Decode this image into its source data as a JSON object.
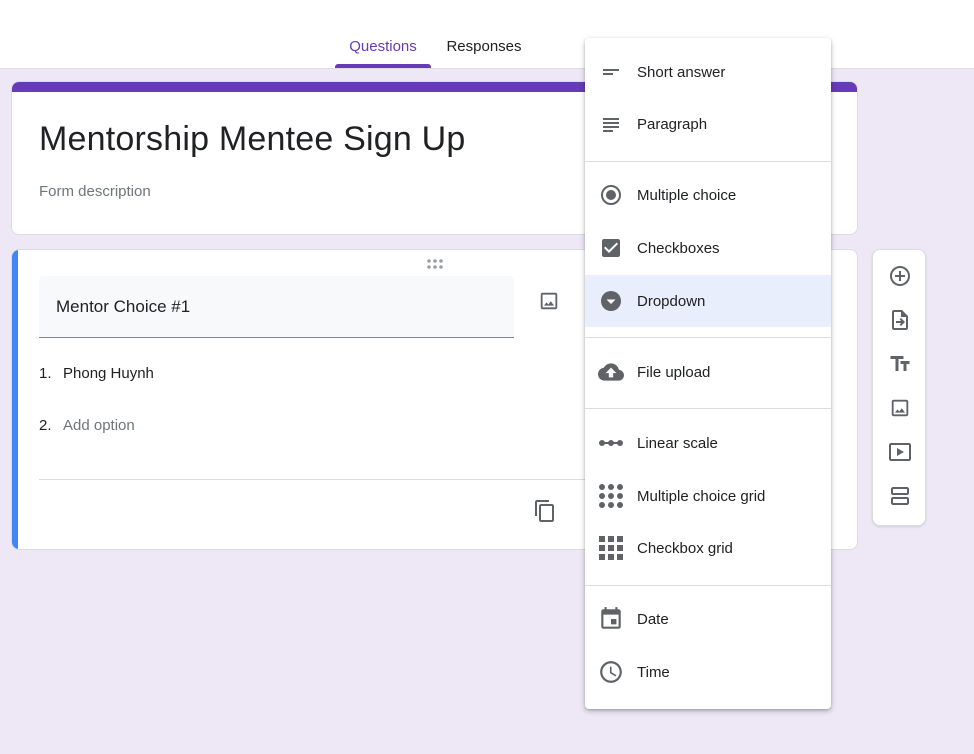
{
  "tabs": {
    "questions": "Questions",
    "responses": "Responses"
  },
  "form": {
    "title": "Mentorship Mentee Sign Up",
    "description_placeholder": "Form description"
  },
  "question": {
    "title": "Mentor Choice #1",
    "options": [
      {
        "num": "1.",
        "text": "Phong Huynh"
      },
      {
        "num": "2.",
        "text": "Add option"
      }
    ]
  },
  "menu": {
    "items": [
      {
        "label": "Short answer",
        "icon": "short-answer-icon"
      },
      {
        "label": "Paragraph",
        "icon": "paragraph-icon"
      },
      {
        "label": "Multiple choice",
        "icon": "radio-button-icon"
      },
      {
        "label": "Checkboxes",
        "icon": "checkbox-icon"
      },
      {
        "label": "Dropdown",
        "icon": "dropdown-circle-icon",
        "selected": true
      },
      {
        "label": "File upload",
        "icon": "cloud-upload-icon"
      },
      {
        "label": "Linear scale",
        "icon": "linear-scale-icon"
      },
      {
        "label": "Multiple choice grid",
        "icon": "dot-grid-icon"
      },
      {
        "label": "Checkbox grid",
        "icon": "square-grid-icon"
      },
      {
        "label": "Date",
        "icon": "calendar-icon"
      },
      {
        "label": "Time",
        "icon": "clock-icon"
      }
    ]
  },
  "toolbar": {
    "items": [
      "add-question-icon",
      "import-questions-icon",
      "add-title-icon",
      "add-image-icon",
      "add-video-icon",
      "add-section-icon"
    ]
  },
  "colors": {
    "accent": "#673ab7",
    "active_bar": "#4285f4",
    "background": "#ede7f6",
    "selected_item": "#e8eefb"
  }
}
